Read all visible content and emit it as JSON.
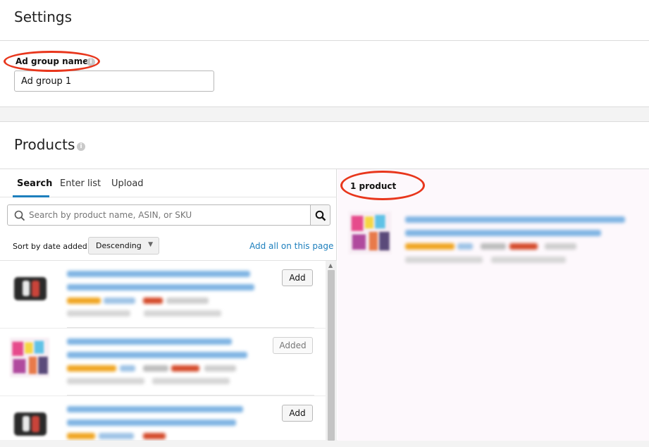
{
  "settings": {
    "title": "Settings",
    "ad_group_label": "Ad group name",
    "ad_group_value": "Ad group 1"
  },
  "products": {
    "title": "Products",
    "tabs": [
      {
        "label": "Search",
        "active": true
      },
      {
        "label": "Enter list",
        "active": false
      },
      {
        "label": "Upload",
        "active": false
      }
    ],
    "search_placeholder": "Search by product name, ASIN, or SKU",
    "sort_label": "Sort by date added",
    "sort_selected": "Descending",
    "add_all_label": "Add all on this page",
    "rows": [
      {
        "thumb": "charging-pad-icon",
        "button_label": "Add",
        "state": "add"
      },
      {
        "thumb": "party-favors-icon",
        "button_label": "Added",
        "state": "added"
      },
      {
        "thumb": "charging-pad-icon",
        "button_label": "Add",
        "state": "add"
      }
    ],
    "selected_count_label": "1 product"
  },
  "colors": {
    "accent_blue": "#1d7fbd",
    "annotation_red": "#e8361c",
    "star_orange": "#f0a521",
    "price_red": "#d44a2a"
  }
}
